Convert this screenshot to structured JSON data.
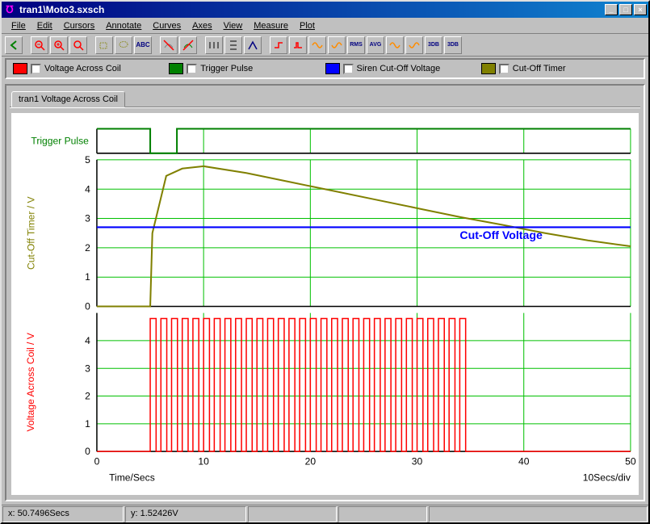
{
  "window": {
    "title": "tran1\\Moto3.sxsch"
  },
  "menu": [
    "File",
    "Edit",
    "Cursors",
    "Annotate",
    "Curves",
    "Axes",
    "View",
    "Measure",
    "Plot"
  ],
  "toolbar_icons": [
    "back",
    "zoom-out",
    "zoom-in",
    "zoom-fit",
    "lasso",
    "lasso-cut",
    "text-tool",
    "divider",
    "undo-curve",
    "redo-curve",
    "ruler-h",
    "ruler-v",
    "caliper",
    "red-step",
    "red-glitch",
    "sine",
    "sine-alt",
    "3db",
    "3db-alt"
  ],
  "legend": [
    {
      "color": "#ff0000",
      "label": "Voltage Across Coil"
    },
    {
      "color": "#008000",
      "label": "Trigger Pulse"
    },
    {
      "color": "#0000ff",
      "label": "Siren Cut-Off Voltage"
    },
    {
      "color": "#808000",
      "label": "Cut-Off Timer"
    }
  ],
  "tab": {
    "label": "tran1 Voltage Across Coil"
  },
  "status": {
    "x": "x: 50.7496Secs",
    "y": "y: 1.52426V"
  },
  "chart_data": {
    "type": "line",
    "xlabel": "Time/Secs",
    "xunit_note": "10Secs/div",
    "xlim": [
      0,
      50
    ],
    "x_ticks": [
      0,
      10,
      20,
      30,
      40,
      50
    ],
    "panels": [
      {
        "label": "Trigger Pulse",
        "label_color": "#008000",
        "ylabel": "",
        "ylim": [
          0,
          1
        ],
        "series": [
          {
            "name": "Trigger Pulse",
            "color": "#008000",
            "x": [
              0,
              5,
              5,
              7.5,
              7.5,
              50
            ],
            "y": [
              1,
              1,
              0,
              0,
              1,
              1
            ]
          }
        ]
      },
      {
        "label": "Cut-Off Timer / V",
        "label_color": "#808000",
        "ylabel": "Cut-Off Timer / V",
        "ylim": [
          0,
          5
        ],
        "y_ticks": [
          0,
          1,
          2,
          3,
          4,
          5
        ],
        "annotation": {
          "text": "Cut-Off Voltage",
          "color": "#0000ff",
          "x": 34,
          "y": 2.3
        },
        "series": [
          {
            "name": "Cut-Off Timer",
            "color": "#808000",
            "x": [
              0,
              5,
              5.2,
              6.5,
              8,
              10,
              14,
              18,
              22,
              26,
              30,
              34,
              38,
              42,
              46,
              50
            ],
            "y": [
              0,
              0,
              2.5,
              4.45,
              4.7,
              4.78,
              4.55,
              4.25,
              3.95,
              3.65,
              3.35,
              3.05,
              2.78,
              2.5,
              2.25,
              2.05
            ]
          },
          {
            "name": "Siren Cut-Off Voltage",
            "color": "#0000ff",
            "x": [
              0,
              50
            ],
            "y": [
              2.7,
              2.7
            ]
          }
        ]
      },
      {
        "label": "Voltage Across Coil / V",
        "label_color": "#ff0000",
        "ylabel": "Voltage Across Coil / V",
        "ylim": [
          0,
          5
        ],
        "y_ticks": [
          0,
          1,
          2,
          3,
          4
        ],
        "series": [
          {
            "name": "Voltage Across Coil",
            "color": "#ff0000",
            "type": "pulse",
            "period": 1.0,
            "duty": 0.55,
            "x_start": 5,
            "x_end": 34.5,
            "amplitude": 4.8
          }
        ]
      }
    ]
  }
}
